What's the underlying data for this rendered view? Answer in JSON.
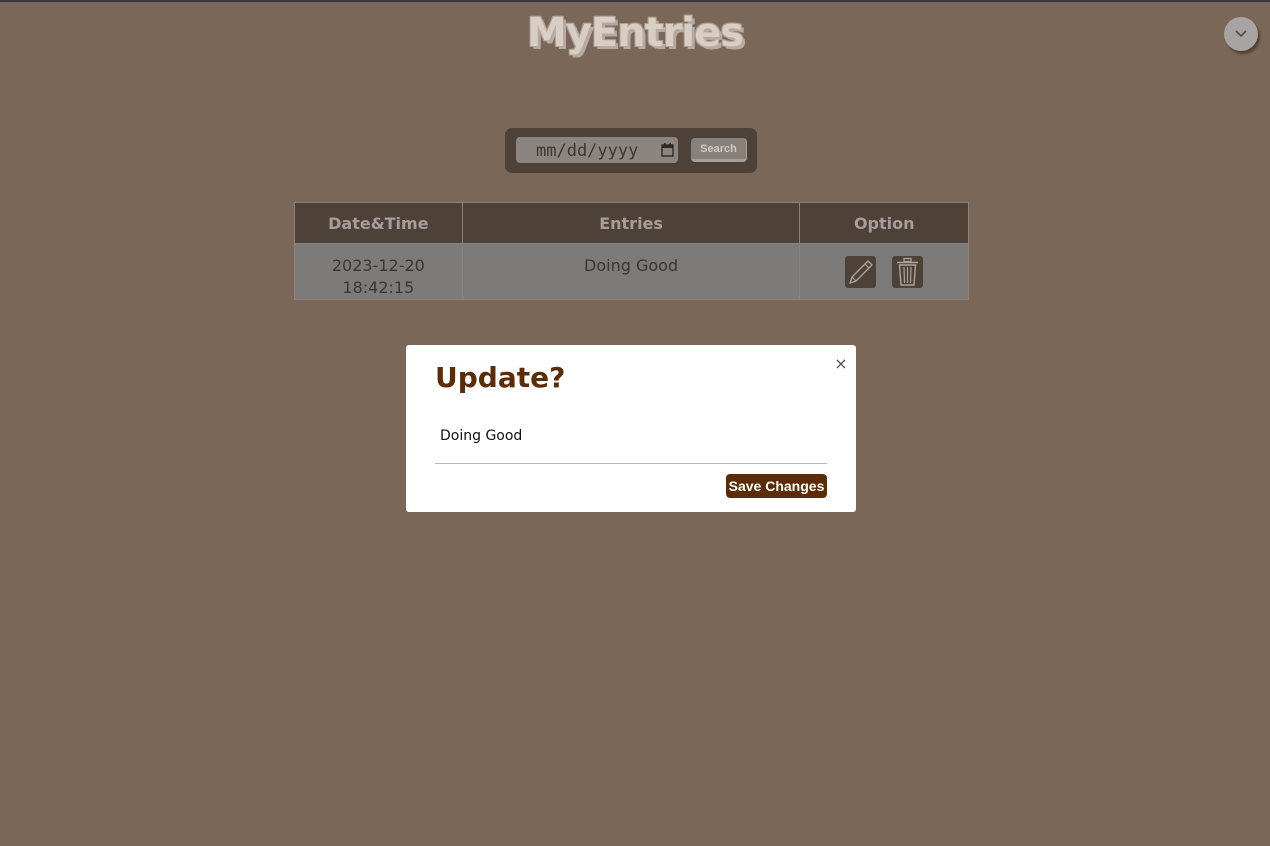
{
  "header": {
    "logo_text": "MyEntries",
    "menu_icon": "chevron-down-icon"
  },
  "search": {
    "date_placeholder": "mm/dd/yyyy",
    "button_label": "Search"
  },
  "table": {
    "headers": [
      "Date&Time",
      "Entries",
      "Option"
    ],
    "rows": [
      {
        "date": "2023-12-20",
        "time": "18:42:15",
        "entry": "Doing Good"
      }
    ]
  },
  "modal": {
    "title": "Update?",
    "close_label": "×",
    "input_value": "Doing Good",
    "save_label": "Save Changes"
  },
  "colors": {
    "background": "#7a6757",
    "accent": "#5c2c06",
    "table_header": "#4e4238"
  }
}
